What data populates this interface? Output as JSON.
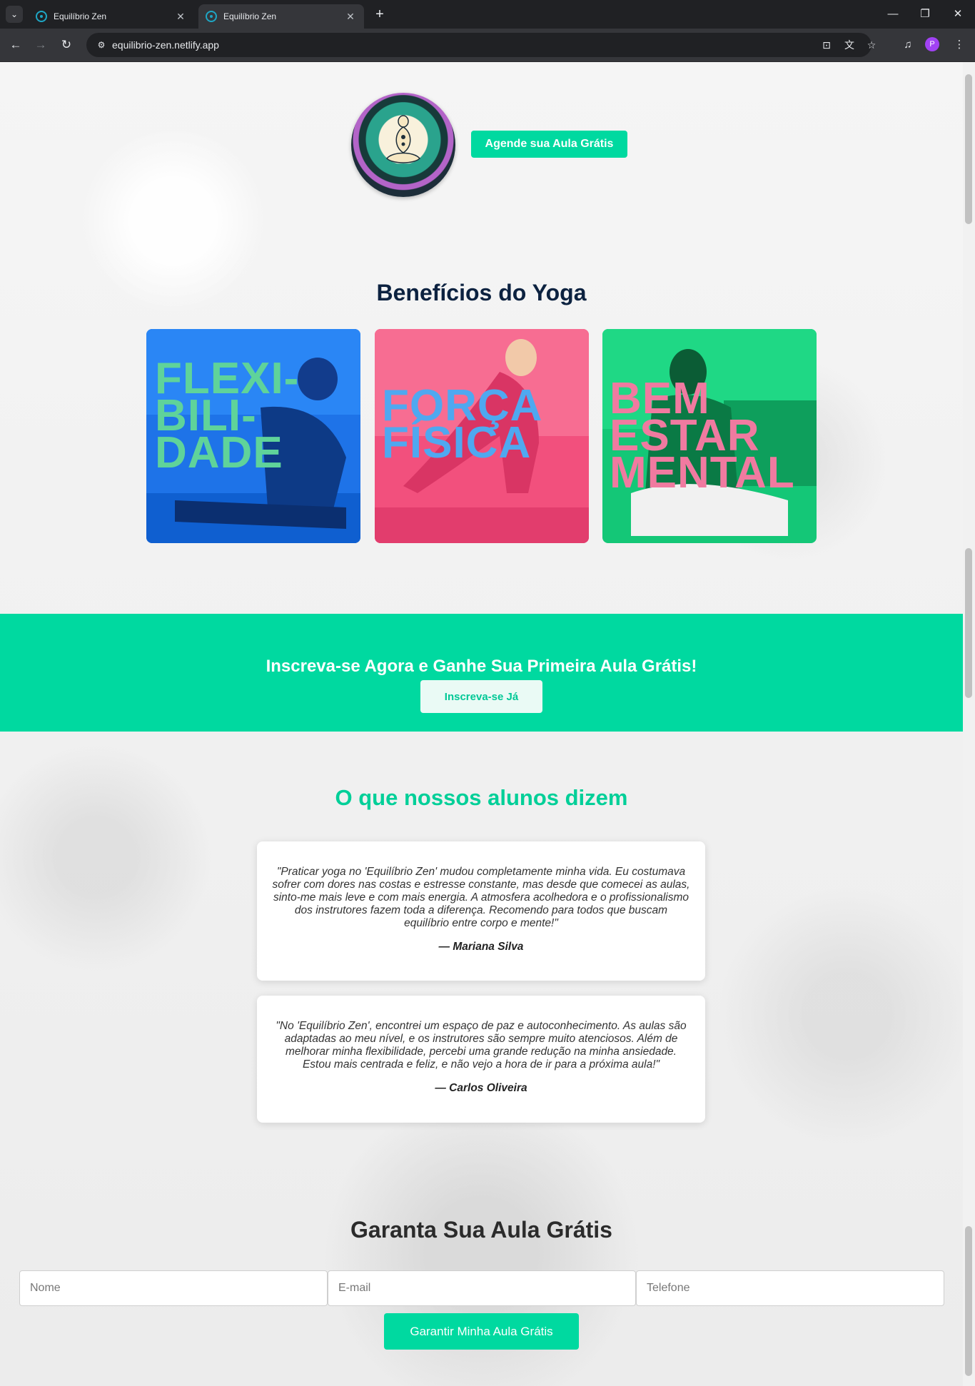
{
  "browser": {
    "tabs": [
      {
        "title": "Equilíbrio Zen",
        "active": false
      },
      {
        "title": "Equilíbrio Zen",
        "active": true
      }
    ],
    "url": "equilibrio-zen.netlify.app",
    "profile_initial": "P",
    "icons": {
      "tab_menu": "chevron-down-icon",
      "new_tab": "plus-icon",
      "minimize": "minimize-icon",
      "restore": "restore-icon",
      "close": "close-icon",
      "back": "arrow-left-icon",
      "forward": "arrow-right-icon",
      "reload": "reload-icon",
      "site_info": "tune-icon",
      "install": "install-app-icon",
      "translate": "translate-icon",
      "bookmark": "star-icon",
      "media": "media-controls-icon",
      "menu": "kebab-menu-icon"
    }
  },
  "header": {
    "logo": "lotus-meditation-logo",
    "cta_label": "Agende sua Aula Grátis"
  },
  "benefits": {
    "title": "Benefícios do Yoga",
    "cards": [
      {
        "text": "FLEXI-\nBILI-\nDADE",
        "bg": "#1e73e8",
        "text_color": "#5fd39a",
        "image": "man-stretching-photo"
      },
      {
        "text": "FORÇA\nFÍSICA",
        "bg": "#f2507d",
        "text_color": "#4fa8f0",
        "image": "woman-cobra-pose-photo"
      },
      {
        "text": "BEM\nESTAR\nMENTAL",
        "bg": "#14c777",
        "text_color": "#f07aa0",
        "image": "man-meditating-photo"
      }
    ]
  },
  "banner": {
    "title": "Inscreva-se Agora e Ganhe Sua Primeira Aula Grátis!",
    "button_label": "Inscreva-se Já"
  },
  "testimonials": {
    "title": "O que nossos alunos dizem",
    "items": [
      {
        "quote": "\"Praticar yoga no 'Equilíbrio Zen' mudou completamente minha vida. Eu costumava sofrer com dores nas costas e estresse constante, mas desde que comecei as aulas, sinto-me mais leve e com mais energia. A atmosfera acolhedora e o profissionalismo dos instrutores fazem toda a diferença. Recomendo para todos que buscam equilíbrio entre corpo e mente!\"",
        "author": "— Mariana Silva"
      },
      {
        "quote": "\"No 'Equilíbrio Zen', encontrei um espaço de paz e autoconhecimento. As aulas são adaptadas ao meu nível, e os instrutores são sempre muito atenciosos. Além de melhorar minha flexibilidade, percebi uma grande redução na minha ansiedade. Estou mais centrada e feliz, e não vejo a hora de ir para a próxima aula!\"",
        "author": "— Carlos Oliveira"
      }
    ]
  },
  "form": {
    "title": "Garanta Sua Aula Grátis",
    "name_placeholder": "Nome",
    "email_placeholder": "E-mail",
    "phone_placeholder": "Telefone",
    "submit_label": "Garantir Minha Aula Grátis"
  },
  "colors": {
    "accent": "#00d9a0",
    "heading_dark": "#0c2240",
    "chrome_dark": "#202124"
  }
}
